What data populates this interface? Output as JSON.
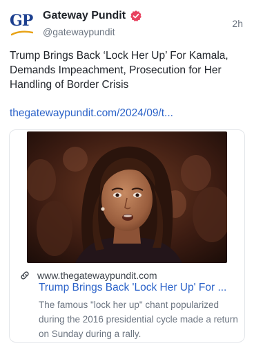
{
  "post": {
    "author": {
      "display_name": "Gateway Pundit",
      "handle": "@gatewaypundit",
      "verified": true,
      "verified_color": "#e8425f",
      "avatar_text": "GP",
      "avatar_colors": {
        "text": "#1c3f8f",
        "swoosh": "#e8a317"
      }
    },
    "timestamp": "2h",
    "text": "Trump Brings Back ‘Lock Her Up’ For Kamala, Demands Impeachment, Prosecution for Her Handling of Border Crisis",
    "link_text": "thegatewaypundit.com/2024/09/t...",
    "link_color": "#2c63c9"
  },
  "card": {
    "link_icon": "link-icon",
    "domain": "www.thegatewaypundit.com",
    "title": "Trump Brings Back 'Lock Her Up' For ...",
    "description": "The famous \"lock her up\" chant popularized during the 2016 presidential cycle made a return on Sunday during a rally.",
    "image_subject": "photo of a woman with shoulder-length dark hair in a dark jacket, crowd blurred behind"
  }
}
